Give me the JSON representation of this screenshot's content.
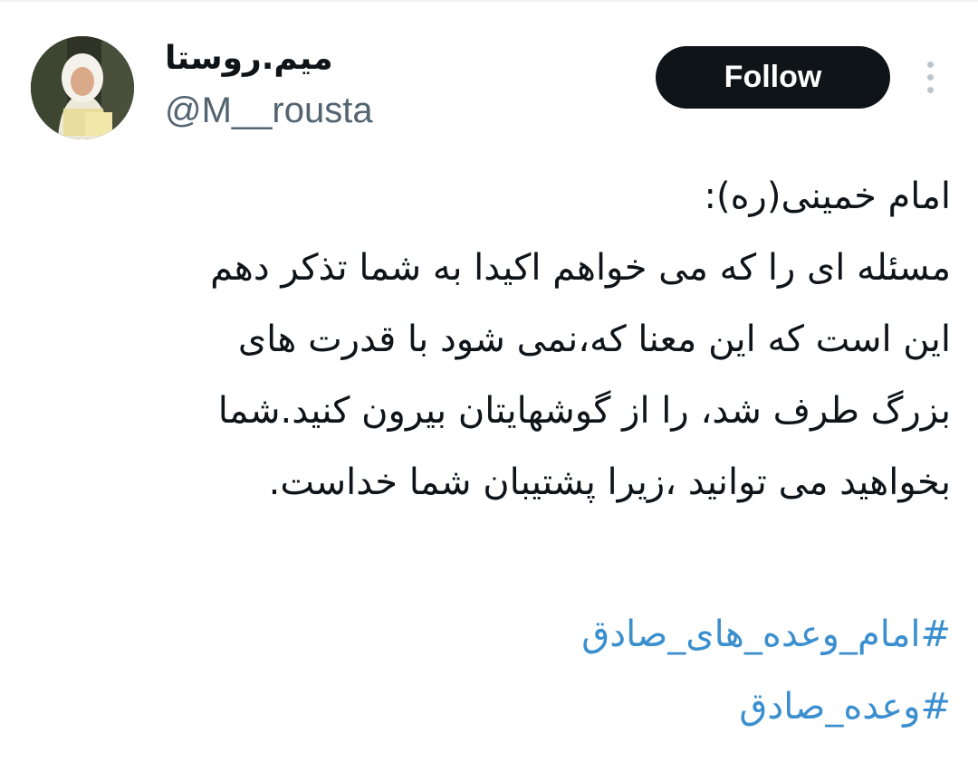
{
  "user": {
    "display_name": "میم.روستا",
    "handle": "@M__rousta"
  },
  "actions": {
    "follow_label": "Follow",
    "more_icon": "more-vertical-icon"
  },
  "tweet": {
    "lines": [
      "امام خمینی(ره):",
      "مسئله ای را که می خواهم اکیدا به شما تذکر دهم",
      "این است که این معنا که،نمی شود با قدرت های",
      "بزرگ طرف شد، را از گوشهایتان بیرون کنید.شما",
      "بخواهید می توانید ،زیرا پشتیبان شما خداست."
    ],
    "hashtags": [
      "#امام_وعده_های_صادق",
      "#وعده_صادق"
    ]
  },
  "colors": {
    "follow_bg": "#0f1419",
    "handle": "#536471",
    "hashtag": "#3b8fcf",
    "text": "#0f1419"
  }
}
